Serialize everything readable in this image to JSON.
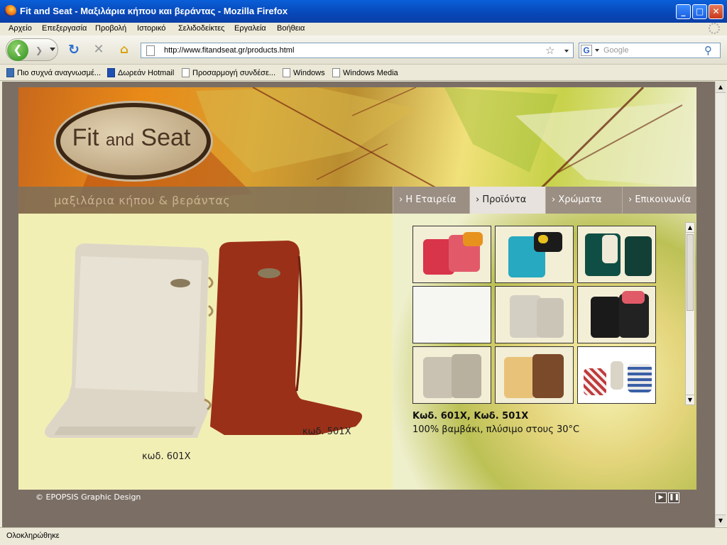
{
  "window": {
    "title": "Fit and Seat - Μαξιλάρια κήπου και βεράντας - Mozilla Firefox",
    "controls": {
      "minimize": "_",
      "maximize": "□",
      "close": "✕"
    }
  },
  "menu": [
    "Αρχείο",
    "Επεξεργασία",
    "Προβολή",
    "Ιστορικό",
    "Σελιδοδείκτες",
    "Εργαλεία",
    "Βοήθεια"
  ],
  "navigation": {
    "url": "http://www.fitandseat.gr/products.html",
    "search_placeholder": "Google",
    "search_engine_letter": "G"
  },
  "bookmarks": [
    "Πιο συχνά αναγνωσμέ...",
    "Δωρεάν Hotmail",
    "Προσαρμογή συνδέσε...",
    "Windows",
    "Windows Media"
  ],
  "site": {
    "logo": {
      "part1": "Fit",
      "part2": "and",
      "part3": "Seat"
    },
    "subtitle": "μαξιλάρια κήπου & βεράντας",
    "nav": [
      {
        "label": "› Η Εταιρεία",
        "active": false
      },
      {
        "label": "› Προϊόντα",
        "active": true
      },
      {
        "label": "› Χρώματα",
        "active": false
      },
      {
        "label": "› Επικοινωνία",
        "active": false
      }
    ],
    "main_image_labels": {
      "left": "κωδ. 601Χ",
      "right": "κωδ. 501Χ"
    },
    "product": {
      "code": "Κωδ. 601Χ, Κωδ. 501Χ",
      "description": "100% βαμβάκι, πλύσιμο στους 30°C"
    },
    "footer": "© EPOPSIS Graphic Design",
    "footer_controls": {
      "play": "▶",
      "pause": "❚❚"
    }
  },
  "status": "Ολοκληρώθηκε",
  "colors": {
    "page_frame": "#7b6f65",
    "left_pane": "#f2efb5",
    "active_tab": "#e7e2dd",
    "nav_bar": "#9b8e82"
  }
}
